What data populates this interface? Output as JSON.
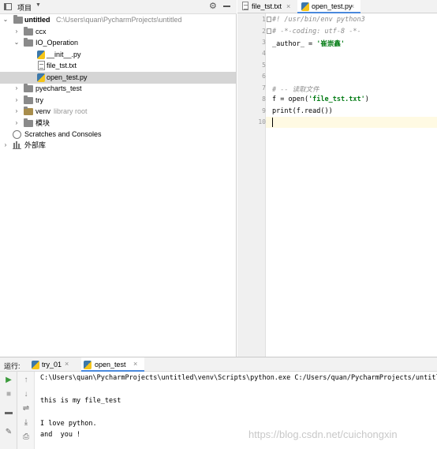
{
  "project_panel": {
    "title": "项目",
    "tree": [
      {
        "label": "untitled",
        "path": "C:\\Users\\quan\\PycharmProjects\\untitled"
      },
      {
        "label": "ccx"
      },
      {
        "label": "IO_Operation"
      },
      {
        "label": "__init__.py"
      },
      {
        "label": "file_tst.txt"
      },
      {
        "label": "open_test.py"
      },
      {
        "label": "pyecharts_test"
      },
      {
        "label": "try"
      },
      {
        "label": "venv",
        "extra": "library root"
      },
      {
        "label": "模块"
      },
      {
        "label": "Scratches and Consoles"
      },
      {
        "label": "外部库"
      }
    ]
  },
  "editor": {
    "tabs": [
      {
        "label": "file_tst.txt"
      },
      {
        "label": "open_test.py"
      }
    ],
    "lines": [
      "1",
      "2",
      "3",
      "4",
      "5",
      "6",
      "7",
      "8",
      "9",
      "10"
    ],
    "code": {
      "l1": "#! /usr/bin/env python3",
      "l2": "# -*-coding: utf-8 -*-",
      "l3a": "_author_ = ",
      "l3b": "'崔崇鑫'",
      "l6": "# -- 读取文件",
      "l7a": "f = open(",
      "l7b": "'file_tst.txt'",
      "l7c": ")",
      "l8": "print(f.read())"
    }
  },
  "run_panel": {
    "label": "运行:",
    "tabs": [
      {
        "label": "try_01"
      },
      {
        "label": "open_test"
      }
    ],
    "output": [
      "C:\\Users\\quan\\PycharmProjects\\untitled\\venv\\Scripts\\python.exe C:/Users/quan/PycharmProjects/untitled",
      "this is my file_test",
      "I love python.",
      "and  you !"
    ]
  },
  "watermark": "https://blog.csdn.net/cuichongxin",
  "colors": {
    "string": "#067d17",
    "comment": "#8c8c8c",
    "selection": "#d5d5d5",
    "current_line": "#fffae3",
    "tab_accent": "#4a89dc"
  }
}
